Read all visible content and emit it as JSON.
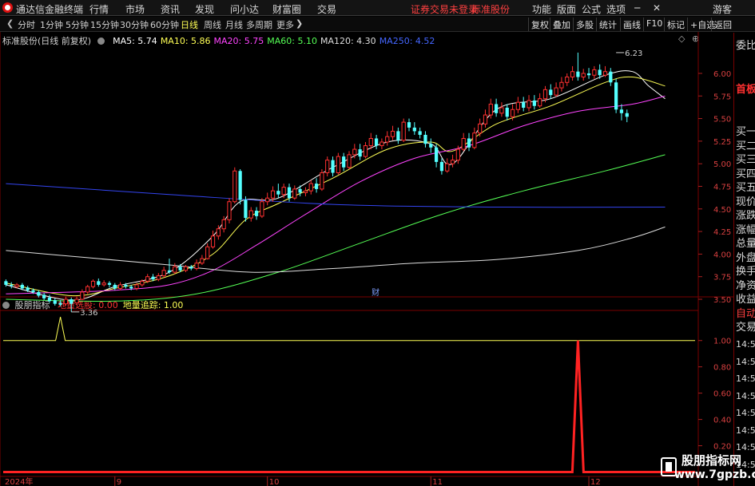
{
  "app": {
    "name": "通达信金融终端",
    "menu": [
      "行情",
      "市场",
      "资讯",
      "发现",
      "问小达",
      "财富圈",
      "交易"
    ],
    "notice": "证券交易未登录",
    "stock_name": "标准股份",
    "right_menu": [
      "功能",
      "版面",
      "公式",
      "选项"
    ],
    "guest": "游客"
  },
  "period_bar": {
    "periods": [
      "分时",
      "1分钟",
      "5分钟",
      "15分钟",
      "30分钟",
      "60分钟",
      "日线",
      "周线",
      "月线",
      "多周期",
      "更多"
    ],
    "active": "日线",
    "tools": [
      "复权",
      "叠加",
      "多股",
      "统计",
      "画线",
      "F10",
      "标记",
      "+自选",
      "返回"
    ]
  },
  "main_legend": {
    "title": "标准股份(日线 前复权)",
    "ma": [
      {
        "label": "MA5: 5.74",
        "color": "#ffffff"
      },
      {
        "label": "MA10: 5.86",
        "color": "#ffff55"
      },
      {
        "label": "MA20: 5.75",
        "color": "#ff44ff"
      },
      {
        "label": "MA60: 5.10",
        "color": "#55ff55"
      },
      {
        "label": "MA120: 4.30",
        "color": "#dddddd"
      },
      {
        "label": "MA250: 4.52",
        "color": "#4466ff"
      }
    ]
  },
  "chart_data": [
    {
      "type": "candlestick",
      "title": "标准股份(日线 前复权)",
      "y_ticks": [
        "6.00",
        "5.75",
        "5.50",
        "5.25",
        "5.00",
        "4.75",
        "4.50",
        "4.25",
        "4.00",
        "3.75",
        "3.50"
      ],
      "ylim": [
        3.35,
        6.3
      ],
      "x_labels": [
        "2024年",
        "9",
        "10",
        "11",
        "12"
      ],
      "x_label_days": [
        0,
        20,
        48,
        78,
        107
      ],
      "n_days": 127,
      "annotations": {
        "high_label": "6.23",
        "high_day": 112,
        "low_label": "3.36",
        "low_day": 12,
        "finance_marker": "财",
        "finance_day": 68
      },
      "candles": [
        [
          3.7,
          3.66,
          3.72,
          3.64
        ],
        [
          3.66,
          3.65,
          3.69,
          3.62
        ],
        [
          3.64,
          3.66,
          3.68,
          3.62
        ],
        [
          3.66,
          3.62,
          3.68,
          3.6
        ],
        [
          3.63,
          3.6,
          3.65,
          3.58
        ],
        [
          3.6,
          3.58,
          3.62,
          3.56
        ],
        [
          3.58,
          3.54,
          3.6,
          3.52
        ],
        [
          3.55,
          3.51,
          3.57,
          3.49
        ],
        [
          3.52,
          3.48,
          3.55,
          3.46
        ],
        [
          3.49,
          3.45,
          3.51,
          3.43
        ],
        [
          3.46,
          3.44,
          3.49,
          3.42
        ],
        [
          3.45,
          3.5,
          3.53,
          3.43
        ],
        [
          3.5,
          3.45,
          3.52,
          3.36
        ],
        [
          3.46,
          3.5,
          3.53,
          3.44
        ],
        [
          3.5,
          3.58,
          3.61,
          3.49
        ],
        [
          3.58,
          3.64,
          3.66,
          3.56
        ],
        [
          3.64,
          3.7,
          3.72,
          3.62
        ],
        [
          3.7,
          3.66,
          3.73,
          3.64
        ],
        [
          3.66,
          3.68,
          3.71,
          3.64
        ],
        [
          3.68,
          3.66,
          3.7,
          3.63
        ],
        [
          3.66,
          3.62,
          3.68,
          3.6
        ],
        [
          3.62,
          3.66,
          3.69,
          3.6
        ],
        [
          3.66,
          3.64,
          3.68,
          3.62
        ],
        [
          3.64,
          3.62,
          3.66,
          3.6
        ],
        [
          3.62,
          3.66,
          3.68,
          3.6
        ],
        [
          3.66,
          3.7,
          3.72,
          3.64
        ],
        [
          3.7,
          3.75,
          3.78,
          3.68
        ],
        [
          3.75,
          3.72,
          3.78,
          3.7
        ],
        [
          3.72,
          3.76,
          3.79,
          3.7
        ],
        [
          3.76,
          3.82,
          3.86,
          3.74
        ],
        [
          3.82,
          3.8,
          3.95,
          3.78
        ],
        [
          3.8,
          3.86,
          3.9,
          3.78
        ],
        [
          3.86,
          3.82,
          3.89,
          3.8
        ],
        [
          3.82,
          3.86,
          3.88,
          3.8
        ],
        [
          3.86,
          3.84,
          3.88,
          3.82
        ],
        [
          3.84,
          3.9,
          3.94,
          3.82
        ],
        [
          3.9,
          3.95,
          3.99,
          3.88
        ],
        [
          3.95,
          4.08,
          4.12,
          3.94
        ],
        [
          4.08,
          4.2,
          4.26,
          4.06
        ],
        [
          4.2,
          4.28,
          4.32,
          4.16
        ],
        [
          4.28,
          4.38,
          4.42,
          4.24
        ],
        [
          4.38,
          4.58,
          4.62,
          4.34
        ],
        [
          4.58,
          4.92,
          4.96,
          4.56
        ],
        [
          4.92,
          4.6,
          4.94,
          4.55
        ],
        [
          4.6,
          4.4,
          4.64,
          4.36
        ],
        [
          4.4,
          4.48,
          4.52,
          4.36
        ],
        [
          4.48,
          4.42,
          4.52,
          4.38
        ],
        [
          4.42,
          4.58,
          4.62,
          4.4
        ],
        [
          4.58,
          4.62,
          4.68,
          4.54
        ],
        [
          4.62,
          4.7,
          4.75,
          4.58
        ],
        [
          4.7,
          4.66,
          4.78,
          4.62
        ],
        [
          4.66,
          4.74,
          4.78,
          4.62
        ],
        [
          4.74,
          4.62,
          4.78,
          4.58
        ],
        [
          4.62,
          4.72,
          4.76,
          4.6
        ],
        [
          4.72,
          4.68,
          4.76,
          4.64
        ],
        [
          4.68,
          4.7,
          4.74,
          4.64
        ],
        [
          4.7,
          4.78,
          4.82,
          4.66
        ],
        [
          4.78,
          4.72,
          4.84,
          4.68
        ],
        [
          4.72,
          4.9,
          4.94,
          4.7
        ],
        [
          4.9,
          5.04,
          5.08,
          4.86
        ],
        [
          5.04,
          4.9,
          5.08,
          4.86
        ],
        [
          4.9,
          5.08,
          5.12,
          4.88
        ],
        [
          5.08,
          4.96,
          5.12,
          4.92
        ],
        [
          4.96,
          5.1,
          5.14,
          4.94
        ],
        [
          5.1,
          5.16,
          5.22,
          5.06
        ],
        [
          5.16,
          5.08,
          5.22,
          5.04
        ],
        [
          5.08,
          5.2,
          5.24,
          5.06
        ],
        [
          5.2,
          5.28,
          5.34,
          5.16
        ],
        [
          5.28,
          5.2,
          5.32,
          5.16
        ],
        [
          5.2,
          5.24,
          5.28,
          5.16
        ],
        [
          5.24,
          5.3,
          5.36,
          5.2
        ],
        [
          5.3,
          5.36,
          5.42,
          5.26
        ],
        [
          5.36,
          5.26,
          5.4,
          5.22
        ],
        [
          5.26,
          5.46,
          5.5,
          5.24
        ],
        [
          5.46,
          5.4,
          5.5,
          5.36
        ],
        [
          5.4,
          5.36,
          5.46,
          5.32
        ],
        [
          5.36,
          5.32,
          5.4,
          5.28
        ],
        [
          5.32,
          5.22,
          5.36,
          5.18
        ],
        [
          5.22,
          5.18,
          5.28,
          5.12
        ],
        [
          5.18,
          5.02,
          5.22,
          4.96
        ],
        [
          5.02,
          4.92,
          5.06,
          4.88
        ],
        [
          4.92,
          5.0,
          5.06,
          4.9
        ],
        [
          5.0,
          5.04,
          5.1,
          4.96
        ],
        [
          5.04,
          5.16,
          5.2,
          5.0
        ],
        [
          5.16,
          5.28,
          5.34,
          5.14
        ],
        [
          5.28,
          5.18,
          5.34,
          5.14
        ],
        [
          5.18,
          5.34,
          5.4,
          5.16
        ],
        [
          5.34,
          5.44,
          5.5,
          5.3
        ],
        [
          5.44,
          5.54,
          5.6,
          5.4
        ],
        [
          5.54,
          5.66,
          5.72,
          5.5
        ],
        [
          5.66,
          5.56,
          5.72,
          5.52
        ],
        [
          5.56,
          5.62,
          5.68,
          5.52
        ],
        [
          5.62,
          5.52,
          5.66,
          5.48
        ],
        [
          5.52,
          5.6,
          5.66,
          5.48
        ],
        [
          5.6,
          5.68,
          5.74,
          5.56
        ],
        [
          5.68,
          5.62,
          5.74,
          5.58
        ],
        [
          5.62,
          5.7,
          5.76,
          5.58
        ],
        [
          5.7,
          5.64,
          5.76,
          5.6
        ],
        [
          5.64,
          5.72,
          5.78,
          5.62
        ],
        [
          5.72,
          5.82,
          5.86,
          5.68
        ],
        [
          5.82,
          5.76,
          5.88,
          5.72
        ],
        [
          5.76,
          5.84,
          5.9,
          5.74
        ],
        [
          5.84,
          5.9,
          5.96,
          5.8
        ],
        [
          5.9,
          5.96,
          6.0,
          5.86
        ],
        [
          5.96,
          6.02,
          6.08,
          5.92
        ],
        [
          6.02,
          5.96,
          6.23,
          5.92
        ],
        [
          5.96,
          6.0,
          6.05,
          5.92
        ],
        [
          6.0,
          5.98,
          6.06,
          5.94
        ],
        [
          5.98,
          6.04,
          6.08,
          5.94
        ],
        [
          6.04,
          5.98,
          6.1,
          5.94
        ],
        [
          5.98,
          6.02,
          6.08,
          5.96
        ],
        [
          6.02,
          5.9,
          6.06,
          5.86
        ],
        [
          5.9,
          5.6,
          5.94,
          5.56
        ],
        [
          5.6,
          5.56,
          5.66,
          5.48
        ],
        [
          5.56,
          5.52,
          5.6,
          5.46
        ]
      ],
      "ma_lines": [
        {
          "name": "MA5",
          "color": "#ffffff",
          "anchors": [
            [
              0,
              3.66
            ],
            [
              12,
              3.49
            ],
            [
              20,
              3.64
            ],
            [
              30,
              3.8
            ],
            [
              38,
              4.2
            ],
            [
              43,
              4.58
            ],
            [
              50,
              4.62
            ],
            [
              60,
              4.96
            ],
            [
              70,
              5.24
            ],
            [
              78,
              5.22
            ],
            [
              82,
              5.0
            ],
            [
              90,
              5.6
            ],
            [
              100,
              5.72
            ],
            [
              110,
              5.98
            ],
            [
              115,
              6.02
            ],
            [
              118,
              5.86
            ],
            [
              121,
              5.72
            ]
          ]
        },
        {
          "name": "MA10",
          "color": "#ffff55",
          "anchors": [
            [
              0,
              3.68
            ],
            [
              12,
              3.54
            ],
            [
              20,
              3.62
            ],
            [
              30,
              3.76
            ],
            [
              38,
              4.0
            ],
            [
              44,
              4.38
            ],
            [
              50,
              4.56
            ],
            [
              60,
              4.84
            ],
            [
              70,
              5.16
            ],
            [
              78,
              5.24
            ],
            [
              82,
              5.14
            ],
            [
              90,
              5.44
            ],
            [
              100,
              5.64
            ],
            [
              110,
              5.9
            ],
            [
              115,
              5.96
            ],
            [
              121,
              5.86
            ]
          ]
        },
        {
          "name": "MA20",
          "color": "#ff44ff",
          "anchors": [
            [
              0,
              3.56
            ],
            [
              12,
              3.58
            ],
            [
              20,
              3.6
            ],
            [
              30,
              3.66
            ],
            [
              38,
              3.82
            ],
            [
              46,
              4.1
            ],
            [
              55,
              4.44
            ],
            [
              65,
              4.8
            ],
            [
              75,
              5.06
            ],
            [
              85,
              5.2
            ],
            [
              95,
              5.42
            ],
            [
              105,
              5.58
            ],
            [
              115,
              5.66
            ],
            [
              121,
              5.75
            ]
          ]
        },
        {
          "name": "MA60",
          "color": "#55ff55",
          "anchors": [
            [
              0,
              3.5
            ],
            [
              20,
              3.48
            ],
            [
              35,
              3.56
            ],
            [
              50,
              3.8
            ],
            [
              65,
              4.12
            ],
            [
              80,
              4.44
            ],
            [
              95,
              4.7
            ],
            [
              110,
              4.92
            ],
            [
              121,
              5.1
            ]
          ]
        },
        {
          "name": "MA120",
          "color": "#dddddd",
          "anchors": [
            [
              0,
              4.04
            ],
            [
              15,
              3.96
            ],
            [
              30,
              3.88
            ],
            [
              45,
              3.8
            ],
            [
              60,
              3.84
            ],
            [
              75,
              3.9
            ],
            [
              90,
              3.94
            ],
            [
              105,
              4.04
            ],
            [
              115,
              4.18
            ],
            [
              121,
              4.3
            ]
          ]
        },
        {
          "name": "MA250",
          "color": "#3344ee",
          "anchors": [
            [
              0,
              4.78
            ],
            [
              30,
              4.66
            ],
            [
              60,
              4.55
            ],
            [
              90,
              4.52
            ],
            [
              121,
              4.52
            ]
          ]
        }
      ]
    },
    {
      "type": "line",
      "title": "股朋指标",
      "y_ticks": [
        "1.00",
        "0.80",
        "0.60",
        "0.40",
        "0.20"
      ],
      "ylim": [
        -0.1,
        1.15
      ],
      "series": [
        {
          "name": "地量选股",
          "color": "#ff2222",
          "value_label": "0.00",
          "spikes": [
            {
              "day": 105,
              "value": 1.0
            }
          ]
        },
        {
          "name": "地量追踪",
          "color": "#ffff55",
          "value_label": "1.00",
          "spikes": [
            {
              "day": 10,
              "value": 1.18
            }
          ]
        }
      ]
    }
  ],
  "indicator_legend": {
    "title": "股朋指标",
    "items": [
      {
        "label": "地量选股: 0.00",
        "color": "#ff3333"
      },
      {
        "label": "地量追踪: 1.00",
        "color": "#ffff55"
      }
    ]
  },
  "right_panel": {
    "top": "委比",
    "red_label": "首板",
    "rows": [
      "买一",
      "买二",
      "买三",
      "买四",
      "买五",
      "现价",
      "涨跌",
      "涨幅",
      "总量",
      "外盘",
      "换手",
      "净资",
      "收益",
      "自动",
      "交易"
    ],
    "times": [
      "14:56",
      "14:56",
      "14:56",
      "14:56",
      "14:56",
      "14:56",
      "14:56",
      "14:56"
    ]
  },
  "watermark": {
    "line1": "股朋指标网",
    "line2": "www.7gpzb.com"
  }
}
